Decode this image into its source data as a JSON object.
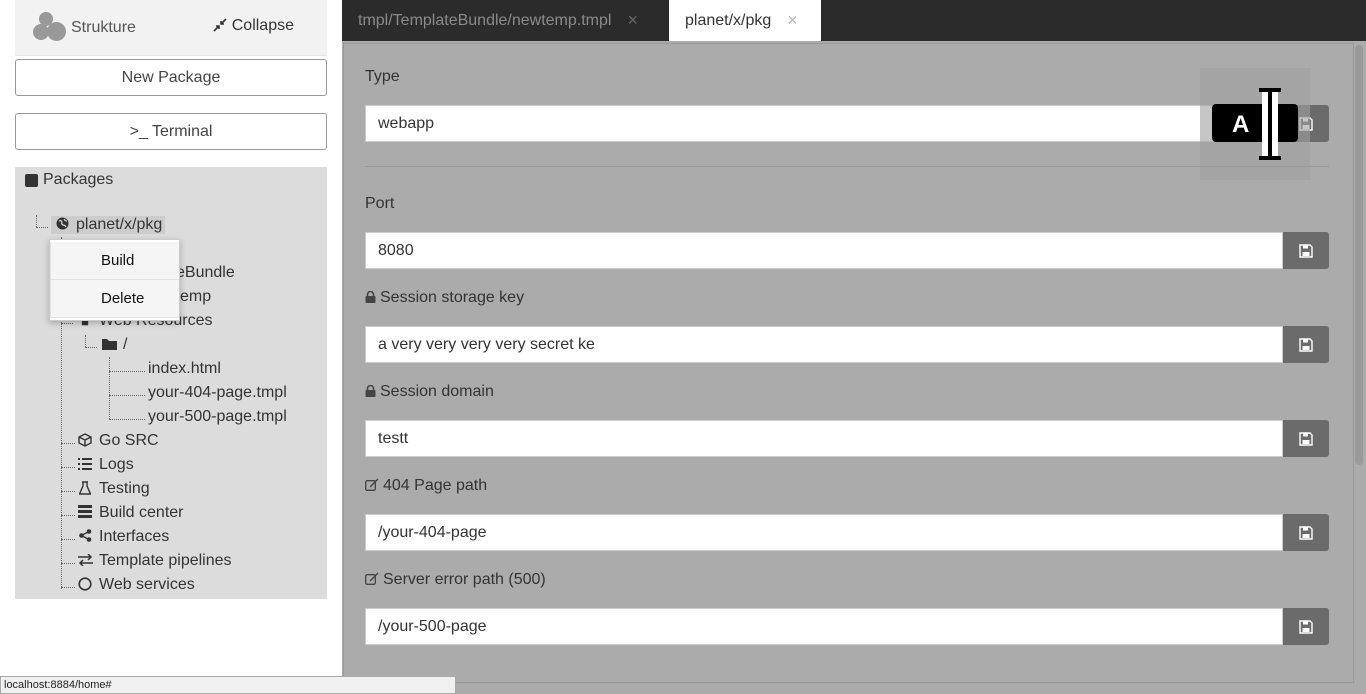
{
  "sidebar": {
    "brand": "Strukture",
    "collapse_label": "Collapse",
    "new_package_label": "New Package",
    "terminal_label": ">_ Terminal",
    "tree_title": "Packages",
    "tree": {
      "root": "planet/x/pkg",
      "hidden1_tail": "eBundle",
      "hidden2_tail": "emp",
      "web_resources": "Web Resources",
      "folder": "/",
      "files": [
        "index.html",
        "your-404-page.tmpl",
        "your-500-page.tmpl"
      ],
      "go_src": "Go SRC",
      "logs": "Logs",
      "testing": "Testing",
      "build_center": "Build center",
      "interfaces": "Interfaces",
      "template_pipelines": "Template pipelines",
      "web_services": "Web services"
    },
    "context_menu": {
      "build": "Build",
      "delete": "Delete"
    }
  },
  "status_bar": "localhost:8884/home#",
  "tabs": [
    {
      "label": "tmpl/TemplateBundle/newtemp.tmpl",
      "active": false
    },
    {
      "label": "planet/x/pkg",
      "active": true
    }
  ],
  "form": {
    "type": {
      "label": "Type",
      "value": "webapp"
    },
    "port": {
      "label": "Port",
      "value": "8080"
    },
    "session_key": {
      "label": "Session storage key",
      "value": "a very very very very secret ke"
    },
    "session_domain": {
      "label": "Session domain",
      "value": "testt"
    },
    "page_404": {
      "label": "404 Page path",
      "value": "/your-404-page"
    },
    "page_500": {
      "label": "Server error path (500)",
      "value": "/your-500-page"
    }
  },
  "cursor_badge": "A",
  "colors": {
    "tab_bar": "#2b2b2b",
    "panel": "#ababab",
    "save_button": "#6b6b6b",
    "tree_bg": "#dcdcdc"
  },
  "icons": {
    "lock": "lock-icon",
    "edit": "edit-icon",
    "save": "floppy-icon"
  }
}
